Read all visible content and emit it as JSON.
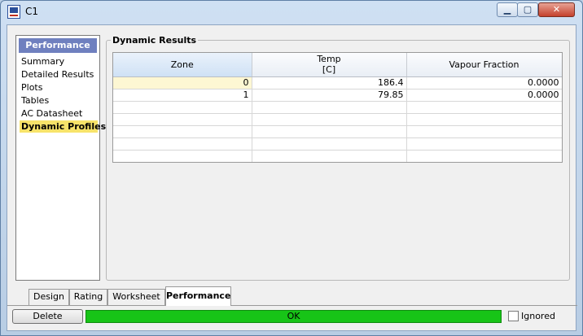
{
  "window": {
    "title": "C1",
    "icon": "hysys-app-icon",
    "controls": {
      "minimize": "▁",
      "maximize": "▢",
      "close": "✕"
    }
  },
  "nav": {
    "header": "Performance",
    "items": [
      {
        "label": "Summary",
        "active": false
      },
      {
        "label": "Detailed Results",
        "active": false
      },
      {
        "label": "Plots",
        "active": false
      },
      {
        "label": "Tables",
        "active": false
      },
      {
        "label": "AC Datasheet",
        "active": false
      },
      {
        "label": "Dynamic Profiles",
        "active": true
      }
    ]
  },
  "results": {
    "group_title": "Dynamic Results",
    "columns": [
      {
        "label": "Zone",
        "unit": ""
      },
      {
        "label": "Temp",
        "unit": "[C]"
      },
      {
        "label": "Vapour Fraction",
        "unit": ""
      }
    ],
    "rows": [
      {
        "zone": "0",
        "temp": "186.4",
        "vapour_fraction": "0.0000"
      },
      {
        "zone": "1",
        "temp": "79.85",
        "vapour_fraction": "0.0000"
      }
    ]
  },
  "tabs": [
    {
      "label": "Design",
      "active": false
    },
    {
      "label": "Rating",
      "active": false
    },
    {
      "label": "Worksheet",
      "active": false
    },
    {
      "label": "Performance",
      "active": true
    }
  ],
  "footer": {
    "delete_label": "Delete",
    "status_text": "OK",
    "status_color": "#17c417",
    "ignored_label": "Ignored",
    "ignored_checked": false
  },
  "colors": {
    "nav_header": "#6f80bf",
    "nav_active": "#f7e36a"
  }
}
